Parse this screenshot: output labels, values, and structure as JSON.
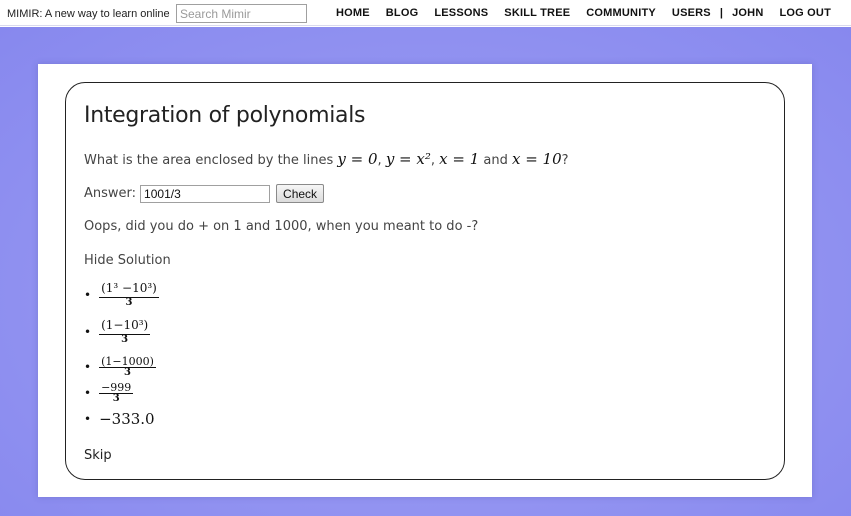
{
  "header": {
    "brand": "MIMIR: A new way to learn online",
    "search_placeholder": "Search Mimir",
    "nav": {
      "home": "HOME",
      "blog": "BLOG",
      "lessons": "LESSONS",
      "skill_tree": "SKILL TREE",
      "community": "COMMUNITY",
      "users": "USERS",
      "separator": "|",
      "user": "JOHN",
      "logout": "LOG OUT"
    }
  },
  "lesson": {
    "title": "Integration of polynomials",
    "question": {
      "prefix": "What is the area enclosed by the lines ",
      "eq1": "y = 0",
      "comma1": ", ",
      "eq2": "y = x²",
      "comma2": ", ",
      "eq3": "x = 1",
      "and": " and ",
      "eq4": "x = 10",
      "suffix": "?"
    },
    "answer_label": "Answer:",
    "answer_value": "1001/3",
    "check_label": "Check",
    "feedback": "Oops, did you do + on 1 and 1000, when you meant to do -?",
    "hide_solution": "Hide Solution",
    "steps": [
      {
        "num": "(1³ −10³)",
        "den": "3"
      },
      {
        "num": "(1−10³)",
        "den": "3"
      },
      {
        "num": "(1−1000)",
        "den": "3"
      },
      {
        "num": "−999",
        "den": "3"
      },
      {
        "value": "−333.0"
      }
    ],
    "skip": "Skip"
  },
  "colors": {
    "backdrop": "#9596f2",
    "card_border": "#222222"
  }
}
